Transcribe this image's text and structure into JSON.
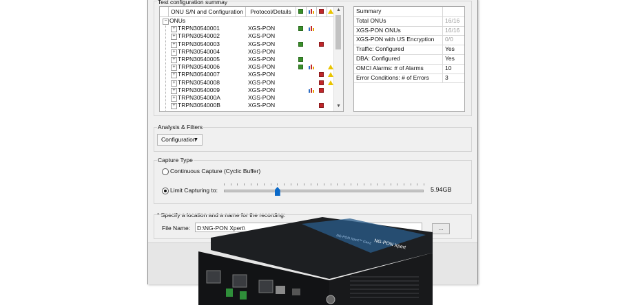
{
  "config": {
    "title": "Test configuration summay",
    "headers": [
      "ONU S/N and Configuration",
      "Protocol/Details"
    ],
    "root": "ONUs",
    "rows": [
      {
        "name": "TRPN30540001",
        "protocol": "XGS-PON",
        "g": 1,
        "b": 1,
        "r": 0,
        "w": 0
      },
      {
        "name": "TRPN30540002",
        "protocol": "XGS-PON",
        "g": 0,
        "b": 0,
        "r": 0,
        "w": 0
      },
      {
        "name": "TRPN30540003",
        "protocol": "XGS-PON",
        "g": 1,
        "b": 0,
        "r": 1,
        "w": 0
      },
      {
        "name": "TRPN30540004",
        "protocol": "XGS-PON",
        "g": 0,
        "b": 0,
        "r": 0,
        "w": 0
      },
      {
        "name": "TRPN30540005",
        "protocol": "XGS-PON",
        "g": 1,
        "b": 0,
        "r": 0,
        "w": 0
      },
      {
        "name": "TRPN30540006",
        "protocol": "XGS-PON",
        "g": 1,
        "b": 1,
        "r": 0,
        "w": 1
      },
      {
        "name": "TRPN30540007",
        "protocol": "XGS-PON",
        "g": 0,
        "b": 0,
        "r": 1,
        "w": 1
      },
      {
        "name": "TRPN30540008",
        "protocol": "XGS-PON",
        "g": 0,
        "b": 0,
        "r": 1,
        "w": 1
      },
      {
        "name": "TRPN30540009",
        "protocol": "XGS-PON",
        "g": 0,
        "b": 1,
        "r": 1,
        "w": 0
      },
      {
        "name": "TRPN3054000A",
        "protocol": "XGS-PON",
        "g": 0,
        "b": 0,
        "r": 0,
        "w": 0
      },
      {
        "name": "TRPN3054000B",
        "protocol": "XGS-PON",
        "g": 0,
        "b": 0,
        "r": 1,
        "w": 0
      }
    ]
  },
  "summary": {
    "header": "Summary",
    "rows": [
      {
        "key": "Total ONUs",
        "value": "16/16",
        "muted": true
      },
      {
        "key": "XGS-PON ONUs",
        "value": "16/16",
        "muted": true
      },
      {
        "key": "XGS-PON with US Encryption",
        "value": "0/0",
        "muted": true
      },
      {
        "key": "Traffic: Configured",
        "value": "Yes",
        "muted": false
      },
      {
        "key": "DBA: Configured",
        "value": "Yes",
        "muted": false
      },
      {
        "key": "OMCI Alarms: # of Alarms",
        "value": "10",
        "muted": false
      },
      {
        "key": "Error Conditions: # of Errors",
        "value": "3",
        "muted": false
      }
    ]
  },
  "analysis": {
    "title": "Analysis & Filters",
    "dropdown": "Configuration"
  },
  "capture": {
    "title": "Capture Type",
    "option_continuous": "Continuous Capture (Cyclic Buffer)",
    "option_limit": "Limit Capturing to:",
    "selected": "limit",
    "size": "5.94GB",
    "slider_fraction": 0.27
  },
  "recording": {
    "note": "* Specify a location and a name for the recording:",
    "file_label": "File Name:",
    "file_value": "D:\\NG-PON Xpert\\",
    "browse_label": "..."
  },
  "device": {
    "brand": "NG-PON Xpert",
    "label": "NG-PON Xpert™ Gen2"
  },
  "colors": {
    "accent": "#0a69c8",
    "ok": "#3a8f2a",
    "alarm": "#c0262a",
    "warning": "#e9c400"
  }
}
